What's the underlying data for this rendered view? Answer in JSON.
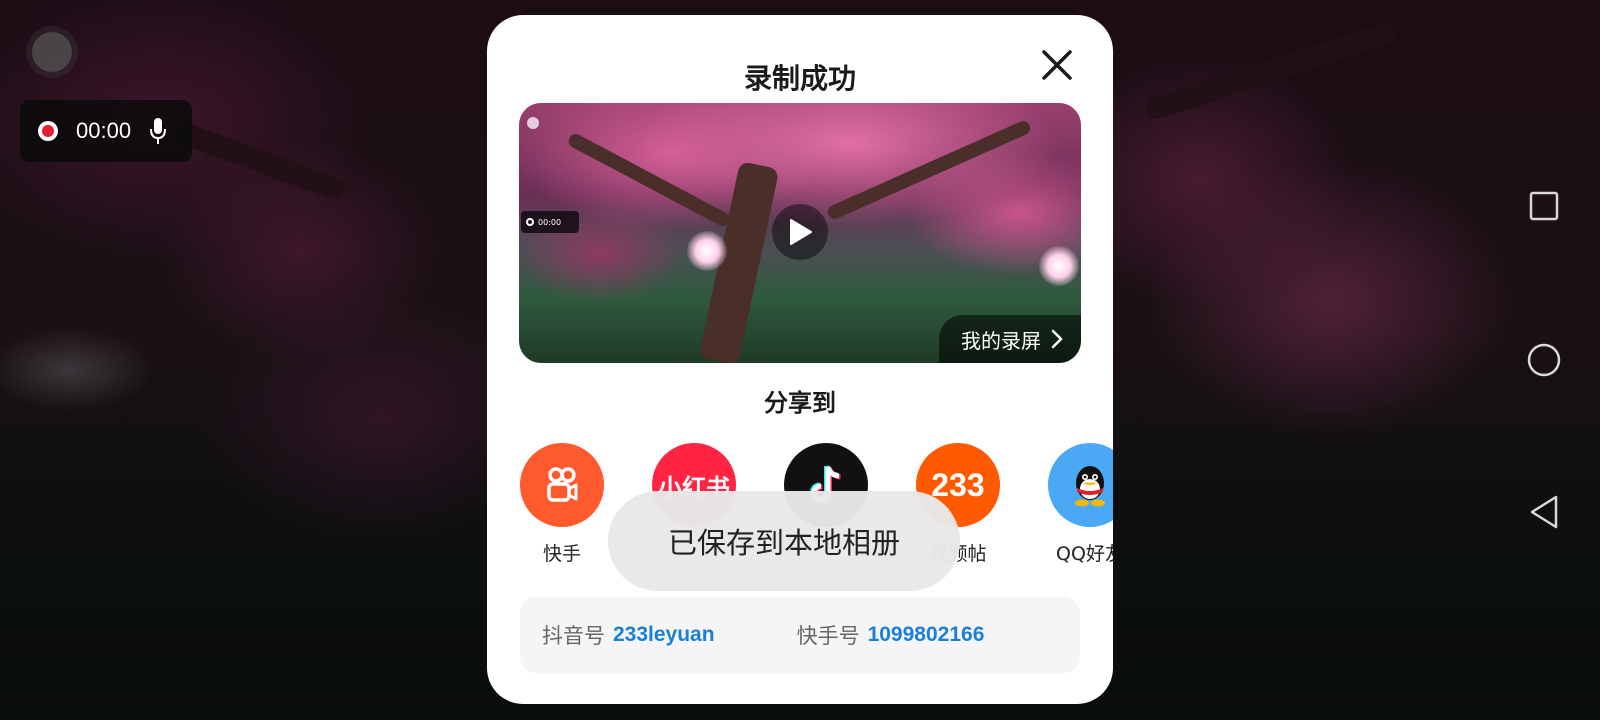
{
  "recorder": {
    "time": "00:00"
  },
  "dialog": {
    "title": "录制成功",
    "thumbnail": {
      "mini_time": "00:00",
      "my_recordings_label": "我的录屏"
    },
    "share_title": "分享到",
    "share_targets": [
      {
        "label": "快手",
        "color": "#ff5a2e",
        "icon": "kuaishou-icon"
      },
      {
        "label": "",
        "color": "#ff2442",
        "icon": "xiaohongshu-icon",
        "icon_text": "小红书"
      },
      {
        "label": "",
        "color": "#111111",
        "icon": "douyin-icon"
      },
      {
        "label": "视频帖",
        "color": "#ff5a00",
        "icon": "233-icon",
        "icon_text": "233"
      },
      {
        "label": "QQ好友",
        "color": "#4aa8f5",
        "icon": "qq-icon"
      }
    ],
    "toast": "已保存到本地相册",
    "accounts": [
      {
        "label": "抖音号",
        "value": "233leyuan"
      },
      {
        "label": "快手号",
        "value": "1099802166"
      }
    ]
  },
  "colors": {
    "link_blue": "#1a7fd6",
    "record_red": "#e02030"
  }
}
